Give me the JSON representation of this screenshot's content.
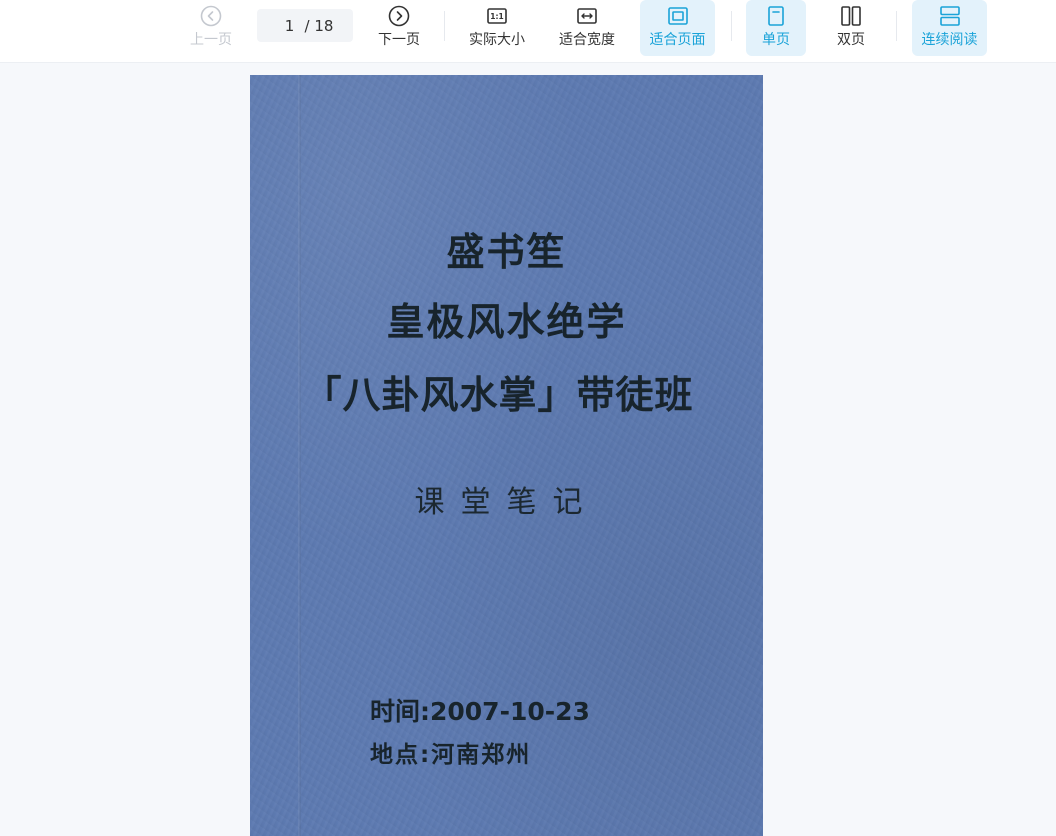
{
  "toolbar": {
    "prev": {
      "label": "上一页",
      "icon": "chevron-left-circle-icon",
      "enabled": false
    },
    "page": {
      "current": "1",
      "total": "/ 18"
    },
    "next": {
      "label": "下一页",
      "icon": "chevron-right-circle-icon"
    },
    "actual_size": {
      "label": "实际大小",
      "icon": "one-to-one-icon"
    },
    "fit_width": {
      "label": "适合宽度",
      "icon": "fit-width-icon"
    },
    "fit_page": {
      "label": "适合页面",
      "icon": "fit-page-icon",
      "active": true
    },
    "single_page": {
      "label": "单页",
      "icon": "single-page-icon",
      "active": true
    },
    "double_page": {
      "label": "双页",
      "icon": "double-page-icon"
    },
    "continuous": {
      "label": "连续阅读",
      "icon": "continuous-read-icon",
      "active": true
    },
    "colors": {
      "active": "#1aa3d8",
      "active_bg": "#e3f2fb",
      "disabled": "#c4c8cf"
    }
  },
  "document": {
    "cover_color": "#5d7ab1",
    "title_line1": "盛书笙",
    "title_line2": "皇极风水绝学",
    "title_line3": "「八卦风水掌」带徒班",
    "subtitle": "课堂笔记",
    "time": "时间:2007-10-23",
    "place": "地点:河南郑州"
  }
}
